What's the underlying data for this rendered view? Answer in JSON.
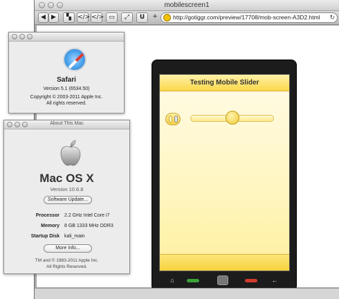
{
  "browser": {
    "title": "mobilescreen1",
    "url": "http://gotiggr.com/preview/17708/mob-screen-A3D2.html",
    "toolbar_icons": [
      "back-icon",
      "forward-icon",
      "grid-icon",
      "source-icon",
      "source-alt-icon",
      "screen-icon",
      "resize-icon",
      "text-icon",
      "add-icon",
      "reload-icon"
    ]
  },
  "phone_app": {
    "header_title": "Testing Mobile Slider",
    "slider_value_fraction": 0.5,
    "nav_buttons": [
      "home-icon",
      "call-icon",
      "camera-icon",
      "end-call-icon",
      "back-arrow-icon"
    ]
  },
  "safari_about": {
    "name": "Safari",
    "version": "Version 5.1 (6534.50)",
    "copyright": "Copyright © 2003-2011 Apple Inc.",
    "rights": "All rights reserved."
  },
  "about_mac": {
    "window_title": "About This Mac",
    "os_name": "Mac OS X",
    "os_version": "Version 10.6.8",
    "update_button": "Software Update...",
    "specs": [
      {
        "label": "Processor",
        "value": "2.2 GHz Intel Core i7"
      },
      {
        "label": "Memory",
        "value": "8 GB 1333 MHz DDR3"
      },
      {
        "label": "Startup Disk",
        "value": "kali_main"
      }
    ],
    "more_info_button": "More Info...",
    "copyright": "TM and © 1983-2011 Apple Inc.",
    "rights": "All Rights Reserved."
  }
}
